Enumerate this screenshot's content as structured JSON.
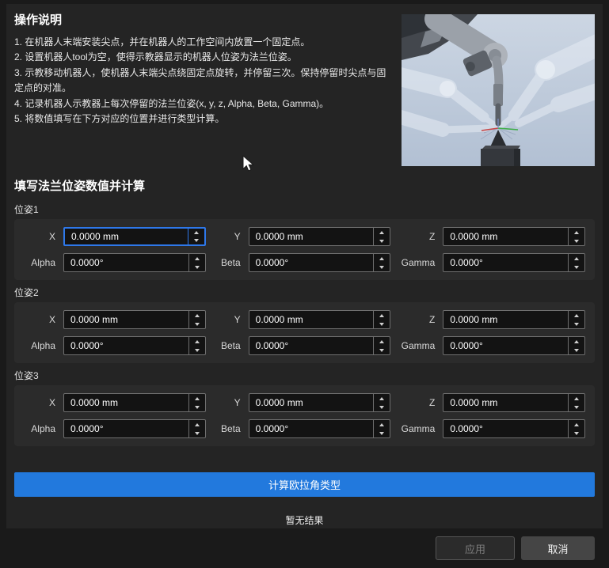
{
  "instructions": {
    "title": "操作说明",
    "steps": [
      "1. 在机器人末端安装尖点，并在机器人的工作空间内放置一个固定点。",
      "2. 设置机器人tool为空，使得示教器显示的机器人位姿为法兰位姿。",
      "3. 示教移动机器人，使机器人末端尖点绕固定点旋转，并停留三次。保持停留时尖点与固定点的对准。",
      "4. 记录机器人示教器上每次停留的法兰位姿(x, y, z, Alpha, Beta, Gamma)。",
      "5. 将数值填写在下方对应的位置并进行类型计算。"
    ]
  },
  "illustration": {
    "name": "robot-tip-rotation-preview",
    "background_top": "#ccd6e3",
    "background_bottom": "#b2c0d3"
  },
  "form": {
    "heading": "填写法兰位姿数值并计算",
    "poses": [
      {
        "label": "位姿1",
        "fields": [
          {
            "label": "X",
            "value": "0.0000 mm"
          },
          {
            "label": "Y",
            "value": "0.0000 mm"
          },
          {
            "label": "Z",
            "value": "0.0000 mm"
          },
          {
            "label": "Alpha",
            "value": "0.0000°"
          },
          {
            "label": "Beta",
            "value": "0.0000°"
          },
          {
            "label": "Gamma",
            "value": "0.0000°"
          }
        ]
      },
      {
        "label": "位姿2",
        "fields": [
          {
            "label": "X",
            "value": "0.0000 mm"
          },
          {
            "label": "Y",
            "value": "0.0000 mm"
          },
          {
            "label": "Z",
            "value": "0.0000 mm"
          },
          {
            "label": "Alpha",
            "value": "0.0000°"
          },
          {
            "label": "Beta",
            "value": "0.0000°"
          },
          {
            "label": "Gamma",
            "value": "0.0000°"
          }
        ]
      },
      {
        "label": "位姿3",
        "fields": [
          {
            "label": "X",
            "value": "0.0000 mm"
          },
          {
            "label": "Y",
            "value": "0.0000 mm"
          },
          {
            "label": "Z",
            "value": "0.0000 mm"
          },
          {
            "label": "Alpha",
            "value": "0.0000°"
          },
          {
            "label": "Beta",
            "value": "0.0000°"
          },
          {
            "label": "Gamma",
            "value": "0.0000°"
          }
        ]
      }
    ]
  },
  "actions": {
    "calculate_label": "计算欧拉角类型",
    "result_text": "暂无结果",
    "apply_label": "应用",
    "cancel_label": "取消"
  },
  "colors": {
    "accent_blue": "#2279dd",
    "focus_border": "#2e78ea",
    "panel_bg": "#242424",
    "group_bg": "#2b2b2b"
  }
}
